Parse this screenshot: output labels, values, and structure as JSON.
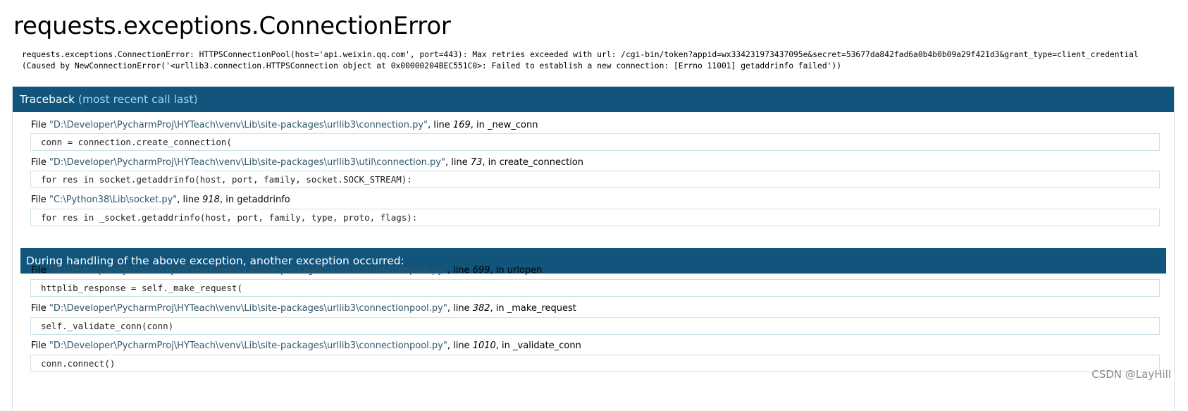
{
  "error": {
    "title": "requests.exceptions.ConnectionError",
    "message_line1": "requests.exceptions.ConnectionError: HTTPSConnectionPool(host='api.weixin.qq.com', port=443): Max retries exceeded with url: /cgi-bin/token?appid=wx334231973437095e&secret=53677da842fad6a0b4b0b09a29f421d3&grant_type=client_credential",
    "message_line2": "(Caused by NewConnectionError('<urllib3.connection.HTTPSConnection object at 0x00000204BEC551C0>: Failed to establish a new connection: [Errno 11001] getaddrinfo failed'))"
  },
  "traceback": {
    "header_label": "Traceback",
    "header_hint": "(most recent call last)",
    "separator_text": "During handling of the above exception, another exception occurred:",
    "frames": [
      {
        "file_prefix": "File ",
        "path": "\"D:\\Developer\\PycharmProj\\HYTeach\\venv\\Lib\\site-packages\\urllib3\\connection.py\"",
        "line_label": ", line ",
        "lineno": "169",
        "in_label": ", in ",
        "func": "_new_conn",
        "code": "conn = connection.create_connection("
      },
      {
        "file_prefix": "File ",
        "path": "\"D:\\Developer\\PycharmProj\\HYTeach\\venv\\Lib\\site-packages\\urllib3\\util\\connection.py\"",
        "line_label": ", line ",
        "lineno": "73",
        "in_label": ", in ",
        "func": "create_connection",
        "code": "for res in socket.getaddrinfo(host, port, family, socket.SOCK_STREAM):"
      },
      {
        "file_prefix": "File ",
        "path": "\"C:\\Python38\\Lib\\socket.py\"",
        "line_label": ", line ",
        "lineno": "918",
        "in_label": ", in ",
        "func": "getaddrinfo",
        "code": "for res in _socket.getaddrinfo(host, port, family, type, proto, flags):"
      },
      {
        "file_prefix": "File ",
        "path": "\"D:\\Developer\\PycharmProj\\HYTeach\\venv\\Lib\\site-packages\\urllib3\\connectionpool.py\"",
        "line_label": ", line ",
        "lineno": "699",
        "in_label": ", in ",
        "func": "urlopen",
        "code": "httplib_response = self._make_request("
      },
      {
        "file_prefix": "File ",
        "path": "\"D:\\Developer\\PycharmProj\\HYTeach\\venv\\Lib\\site-packages\\urllib3\\connectionpool.py\"",
        "line_label": ", line ",
        "lineno": "382",
        "in_label": ", in ",
        "func": "_make_request",
        "code": "self._validate_conn(conn)"
      },
      {
        "file_prefix": "File ",
        "path": "\"D:\\Developer\\PycharmProj\\HYTeach\\venv\\Lib\\site-packages\\urllib3\\connectionpool.py\"",
        "line_label": ", line ",
        "lineno": "1010",
        "in_label": ", in ",
        "func": "_validate_conn",
        "code": "conn.connect()"
      }
    ]
  },
  "watermark": "CSDN @LayHill",
  "colors": {
    "header_bg": "#11557c",
    "header_text": "#ffffff",
    "header_hint": "#9fd4f5",
    "path_text": "#31586c",
    "code_border": "#cde0ea"
  }
}
